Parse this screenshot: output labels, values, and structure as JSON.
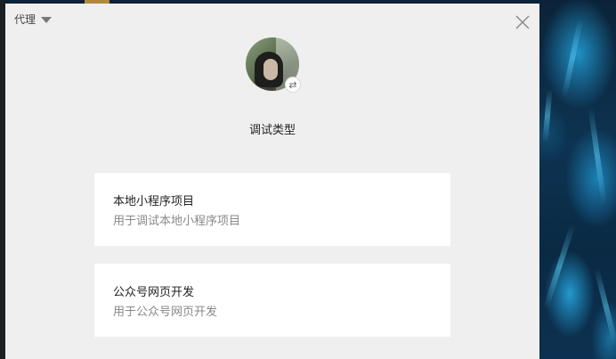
{
  "window": {
    "proxy_menu_label": "代理",
    "close_icon": "close-icon",
    "section_title": "调试类型"
  },
  "avatar": {
    "switch_icon": "⇄"
  },
  "debug_types": [
    {
      "title": "本地小程序项目",
      "description": "用于调试本地小程序项目"
    },
    {
      "title": "公众号网页开发",
      "description": "用于公众号网页开发"
    }
  ],
  "colors": {
    "window_bg": "#efefef",
    "card_bg": "#ffffff",
    "title_text": "#222222",
    "desc_text": "#888888"
  }
}
